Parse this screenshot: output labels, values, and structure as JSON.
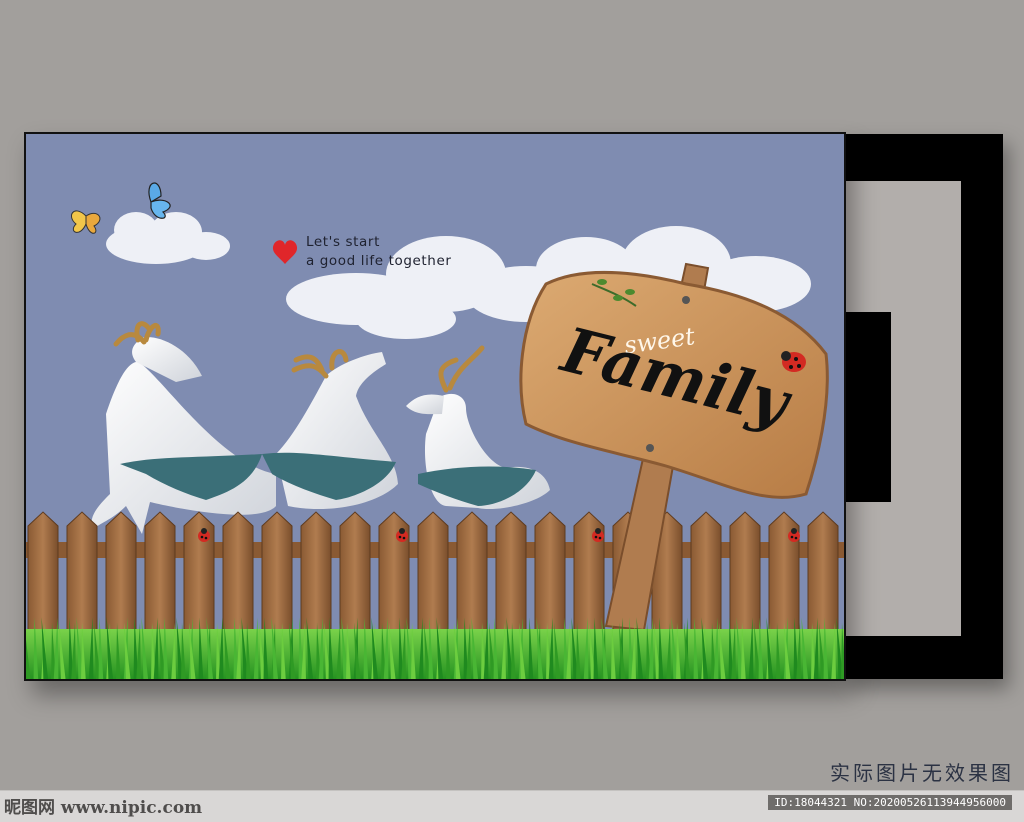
{
  "artwork": {
    "tagline_line1": "Let's start",
    "tagline_line2": "a good life together",
    "sign_small_text": "sweet",
    "sign_main_text": "Family",
    "colors": {
      "sky": "#7f8cb1",
      "fence": "#a4744a",
      "grass": "#3fb02f",
      "sign": "#c9935e",
      "heart": "#e0262a"
    },
    "icons": [
      "heart-icon",
      "butterfly-icon",
      "ladybug-icon",
      "deer-figure",
      "cloud"
    ]
  },
  "caption": "实际图片无效果图",
  "footer": {
    "watermark": "昵图网 www.nipic.com",
    "id_text": "ID:18044321 NO:20200526113944956000"
  }
}
